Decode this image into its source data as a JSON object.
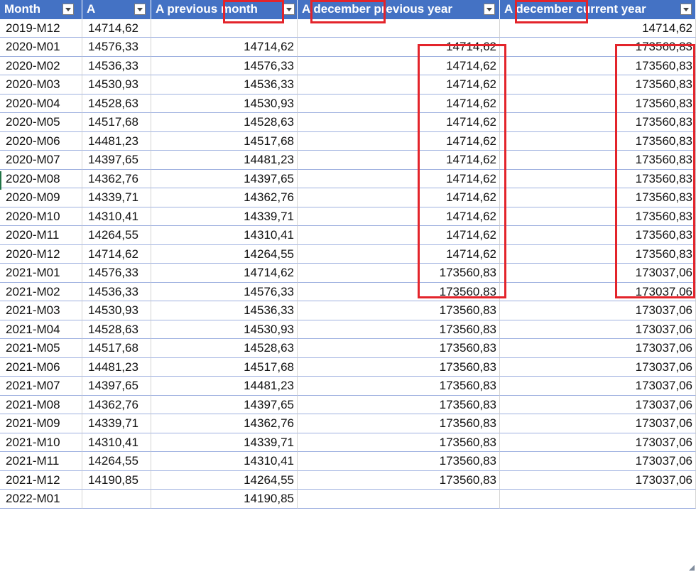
{
  "headers": [
    "Month",
    "A",
    "A previous month",
    "A december previous year",
    "A december current year"
  ],
  "rows": [
    [
      "2019-M12",
      "14714,62",
      "",
      "",
      "14714,62"
    ],
    [
      "2020-M01",
      "14576,33",
      "14714,62",
      "14714,62",
      "173560,83"
    ],
    [
      "2020-M02",
      "14536,33",
      "14576,33",
      "14714,62",
      "173560,83"
    ],
    [
      "2020-M03",
      "14530,93",
      "14536,33",
      "14714,62",
      "173560,83"
    ],
    [
      "2020-M04",
      "14528,63",
      "14530,93",
      "14714,62",
      "173560,83"
    ],
    [
      "2020-M05",
      "14517,68",
      "14528,63",
      "14714,62",
      "173560,83"
    ],
    [
      "2020-M06",
      "14481,23",
      "14517,68",
      "14714,62",
      "173560,83"
    ],
    [
      "2020-M07",
      "14397,65",
      "14481,23",
      "14714,62",
      "173560,83"
    ],
    [
      "2020-M08",
      "14362,76",
      "14397,65",
      "14714,62",
      "173560,83"
    ],
    [
      "2020-M09",
      "14339,71",
      "14362,76",
      "14714,62",
      "173560,83"
    ],
    [
      "2020-M10",
      "14310,41",
      "14339,71",
      "14714,62",
      "173560,83"
    ],
    [
      "2020-M11",
      "14264,55",
      "14310,41",
      "14714,62",
      "173560,83"
    ],
    [
      "2020-M12",
      "14714,62",
      "14264,55",
      "14714,62",
      "173560,83"
    ],
    [
      "2021-M01",
      "14576,33",
      "14714,62",
      "173560,83",
      "173037,06"
    ],
    [
      "2021-M02",
      "14536,33",
      "14576,33",
      "173560,83",
      "173037,06"
    ],
    [
      "2021-M03",
      "14530,93",
      "14536,33",
      "173560,83",
      "173037,06"
    ],
    [
      "2021-M04",
      "14528,63",
      "14530,93",
      "173560,83",
      "173037,06"
    ],
    [
      "2021-M05",
      "14517,68",
      "14528,63",
      "173560,83",
      "173037,06"
    ],
    [
      "2021-M06",
      "14481,23",
      "14517,68",
      "173560,83",
      "173037,06"
    ],
    [
      "2021-M07",
      "14397,65",
      "14481,23",
      "173560,83",
      "173037,06"
    ],
    [
      "2021-M08",
      "14362,76",
      "14397,65",
      "173560,83",
      "173037,06"
    ],
    [
      "2021-M09",
      "14339,71",
      "14362,76",
      "173560,83",
      "173037,06"
    ],
    [
      "2021-M10",
      "14310,41",
      "14339,71",
      "173560,83",
      "173037,06"
    ],
    [
      "2021-M11",
      "14264,55",
      "14310,41",
      "173560,83",
      "173037,06"
    ],
    [
      "2021-M12",
      "14190,85",
      "14264,55",
      "173560,83",
      "173037,06"
    ],
    [
      "2022-M01",
      "",
      "14190,85",
      "",
      ""
    ]
  ],
  "colors": {
    "header_bg": "#4472c4",
    "header_text": "#ffffff",
    "highlight": "#e3242b",
    "row_line": "#9fb1e0"
  },
  "icons": {
    "filter": "filter-dropdown-icon"
  }
}
